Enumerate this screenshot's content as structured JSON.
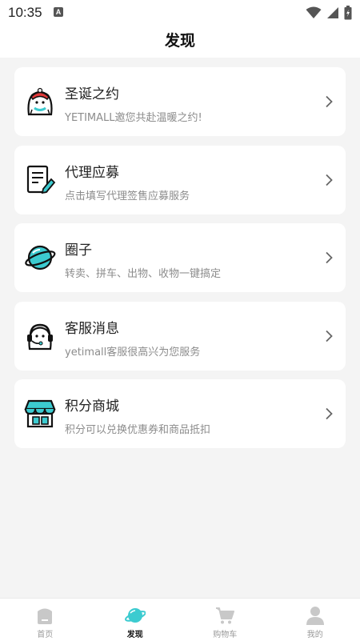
{
  "status_bar": {
    "time": "10:35",
    "notification_icon": "a-icon",
    "icons": [
      "wifi-icon",
      "signal-icon",
      "battery-icon"
    ]
  },
  "header": {
    "title": "发现"
  },
  "menu": [
    {
      "title": "圣诞之约",
      "subtitle": "YETIMALL邀您共赴温暖之约!",
      "icon": "christmas-yeti-icon"
    },
    {
      "title": "代理应募",
      "subtitle": "点击填写代理签售应募服务",
      "icon": "form-pencil-icon"
    },
    {
      "title": "圈子",
      "subtitle": "转卖、拼车、出物、收物一键搞定",
      "icon": "planet-icon"
    },
    {
      "title": "客服消息",
      "subtitle": "yetimall客服很高兴为您服务",
      "icon": "headset-yeti-icon"
    },
    {
      "title": "积分商城",
      "subtitle": "积分可以兑换优惠券和商品抵扣",
      "icon": "shop-icon"
    }
  ],
  "tabbar": {
    "active": "发现",
    "tabs": [
      {
        "label": "首页",
        "icon": "home-icon"
      },
      {
        "label": "发现",
        "icon": "planet-icon"
      },
      {
        "label": "购物车",
        "icon": "cart-icon"
      },
      {
        "label": "我的",
        "icon": "user-icon"
      }
    ]
  },
  "colors": {
    "accent": "#3ccbd0",
    "background": "#f4f4f4",
    "card": "#ffffff",
    "muted_text": "#8c8c8c",
    "inactive_tab": "#c8c8c8"
  }
}
